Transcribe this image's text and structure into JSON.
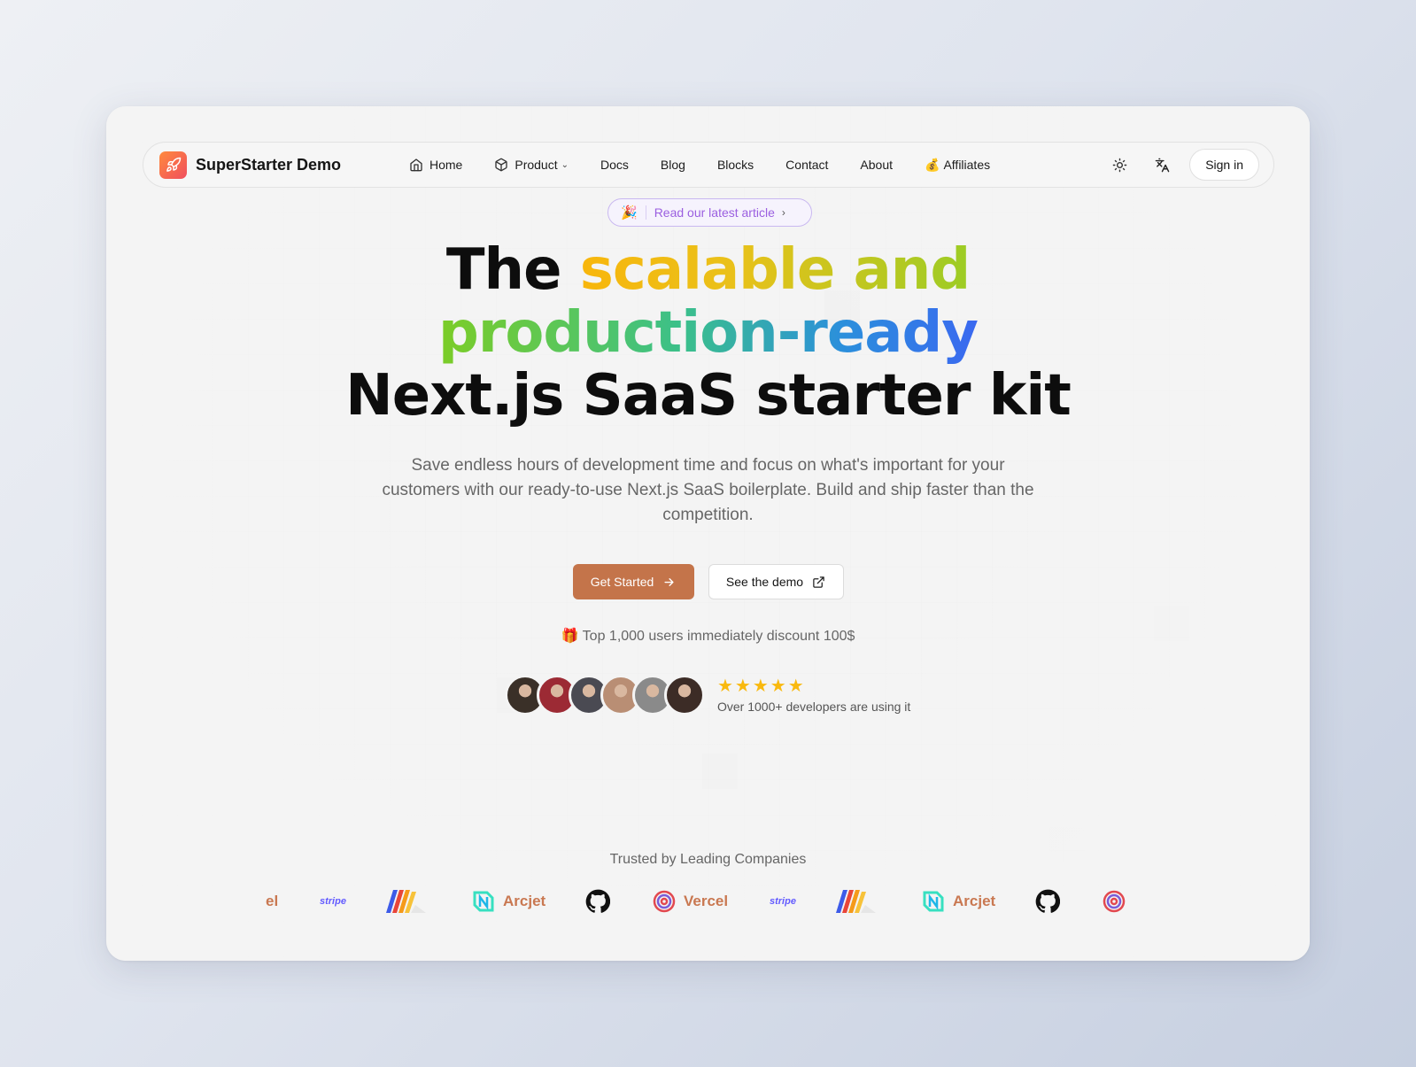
{
  "brand": {
    "name": "SuperStarter Demo",
    "logo_icon": "rocket-icon"
  },
  "nav": {
    "items": [
      {
        "label": "Home",
        "icon": "home-icon"
      },
      {
        "label": "Product",
        "icon": "box-icon",
        "has_dropdown": true
      },
      {
        "label": "Docs"
      },
      {
        "label": "Blog"
      },
      {
        "label": "Blocks"
      },
      {
        "label": "Contact"
      },
      {
        "label": "About"
      },
      {
        "label": "Affiliates",
        "icon": "money-bag-icon"
      }
    ],
    "theme_icon": "sun-icon",
    "language_icon": "translate-icon",
    "signin_label": "Sign in"
  },
  "announcement": {
    "emoji": "🎉",
    "text": "Read our latest article",
    "arrow": "›"
  },
  "hero": {
    "line1_plain": "The ",
    "line1_gradient": "scalable and",
    "line2_gradient": "production-ready",
    "line3": "Next.js SaaS starter kit",
    "subtitle": "Save endless hours of development time and focus on what's important for your customers with our ready-to-use Next.js SaaS boilerplate. Build and ship faster than the competition."
  },
  "cta": {
    "primary_label": "Get Started",
    "secondary_label": "See the demo"
  },
  "promo": {
    "emoji": "🎁",
    "text": "Top 1,000 users immediately discount 100$"
  },
  "social_proof": {
    "stars": "★★★★★",
    "rating": 5,
    "text": "Over 1000+ developers are using it",
    "avatar_colors": [
      "#3a3028",
      "#9c2a34",
      "#4a4a52",
      "#b98e74",
      "#8a8a8a",
      "#3c2c26"
    ]
  },
  "trusted": {
    "title": "Trusted by Leading Companies",
    "logos": [
      "el",
      "stripe",
      "",
      "Arcjet",
      "",
      "Vercel",
      "stripe",
      "",
      "Arcjet",
      "",
      ""
    ]
  },
  "colors": {
    "accent": "#c4744a",
    "announcement": "#9b5fe0",
    "star": "#f9b90f"
  }
}
